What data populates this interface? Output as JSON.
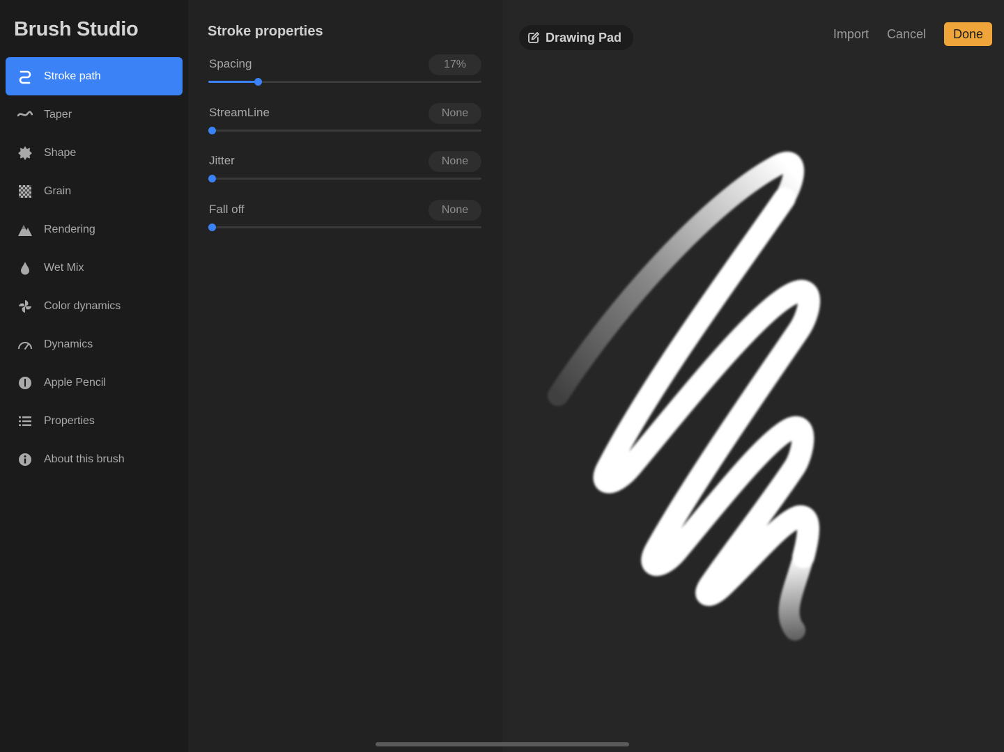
{
  "sidebar": {
    "title": "Brush Studio",
    "items": [
      {
        "label": "Stroke path",
        "icon": "stroke-path-icon",
        "active": true
      },
      {
        "label": "Taper",
        "icon": "taper-icon",
        "active": false
      },
      {
        "label": "Shape",
        "icon": "shape-icon",
        "active": false
      },
      {
        "label": "Grain",
        "icon": "grain-icon",
        "active": false
      },
      {
        "label": "Rendering",
        "icon": "rendering-icon",
        "active": false
      },
      {
        "label": "Wet Mix",
        "icon": "wet-mix-icon",
        "active": false
      },
      {
        "label": "Color dynamics",
        "icon": "color-dynamics-icon",
        "active": false
      },
      {
        "label": "Dynamics",
        "icon": "dynamics-icon",
        "active": false
      },
      {
        "label": "Apple Pencil",
        "icon": "apple-pencil-icon",
        "active": false
      },
      {
        "label": "Properties",
        "icon": "properties-icon",
        "active": false
      },
      {
        "label": "About this brush",
        "icon": "info-icon",
        "active": false
      }
    ]
  },
  "panel": {
    "title": "Stroke properties",
    "settings": [
      {
        "label": "Spacing",
        "value": "17%",
        "level": 0.18
      },
      {
        "label": "StreamLine",
        "value": "None",
        "level": 0
      },
      {
        "label": "Jitter",
        "value": "None",
        "level": 0
      },
      {
        "label": "Fall off",
        "value": "None",
        "level": 0
      }
    ]
  },
  "pad": {
    "label": "Drawing Pad",
    "import_label": "Import",
    "cancel_label": "Cancel",
    "done_label": "Done"
  },
  "colors": {
    "accent": "#3b82f6",
    "done": "#f0a53a"
  }
}
